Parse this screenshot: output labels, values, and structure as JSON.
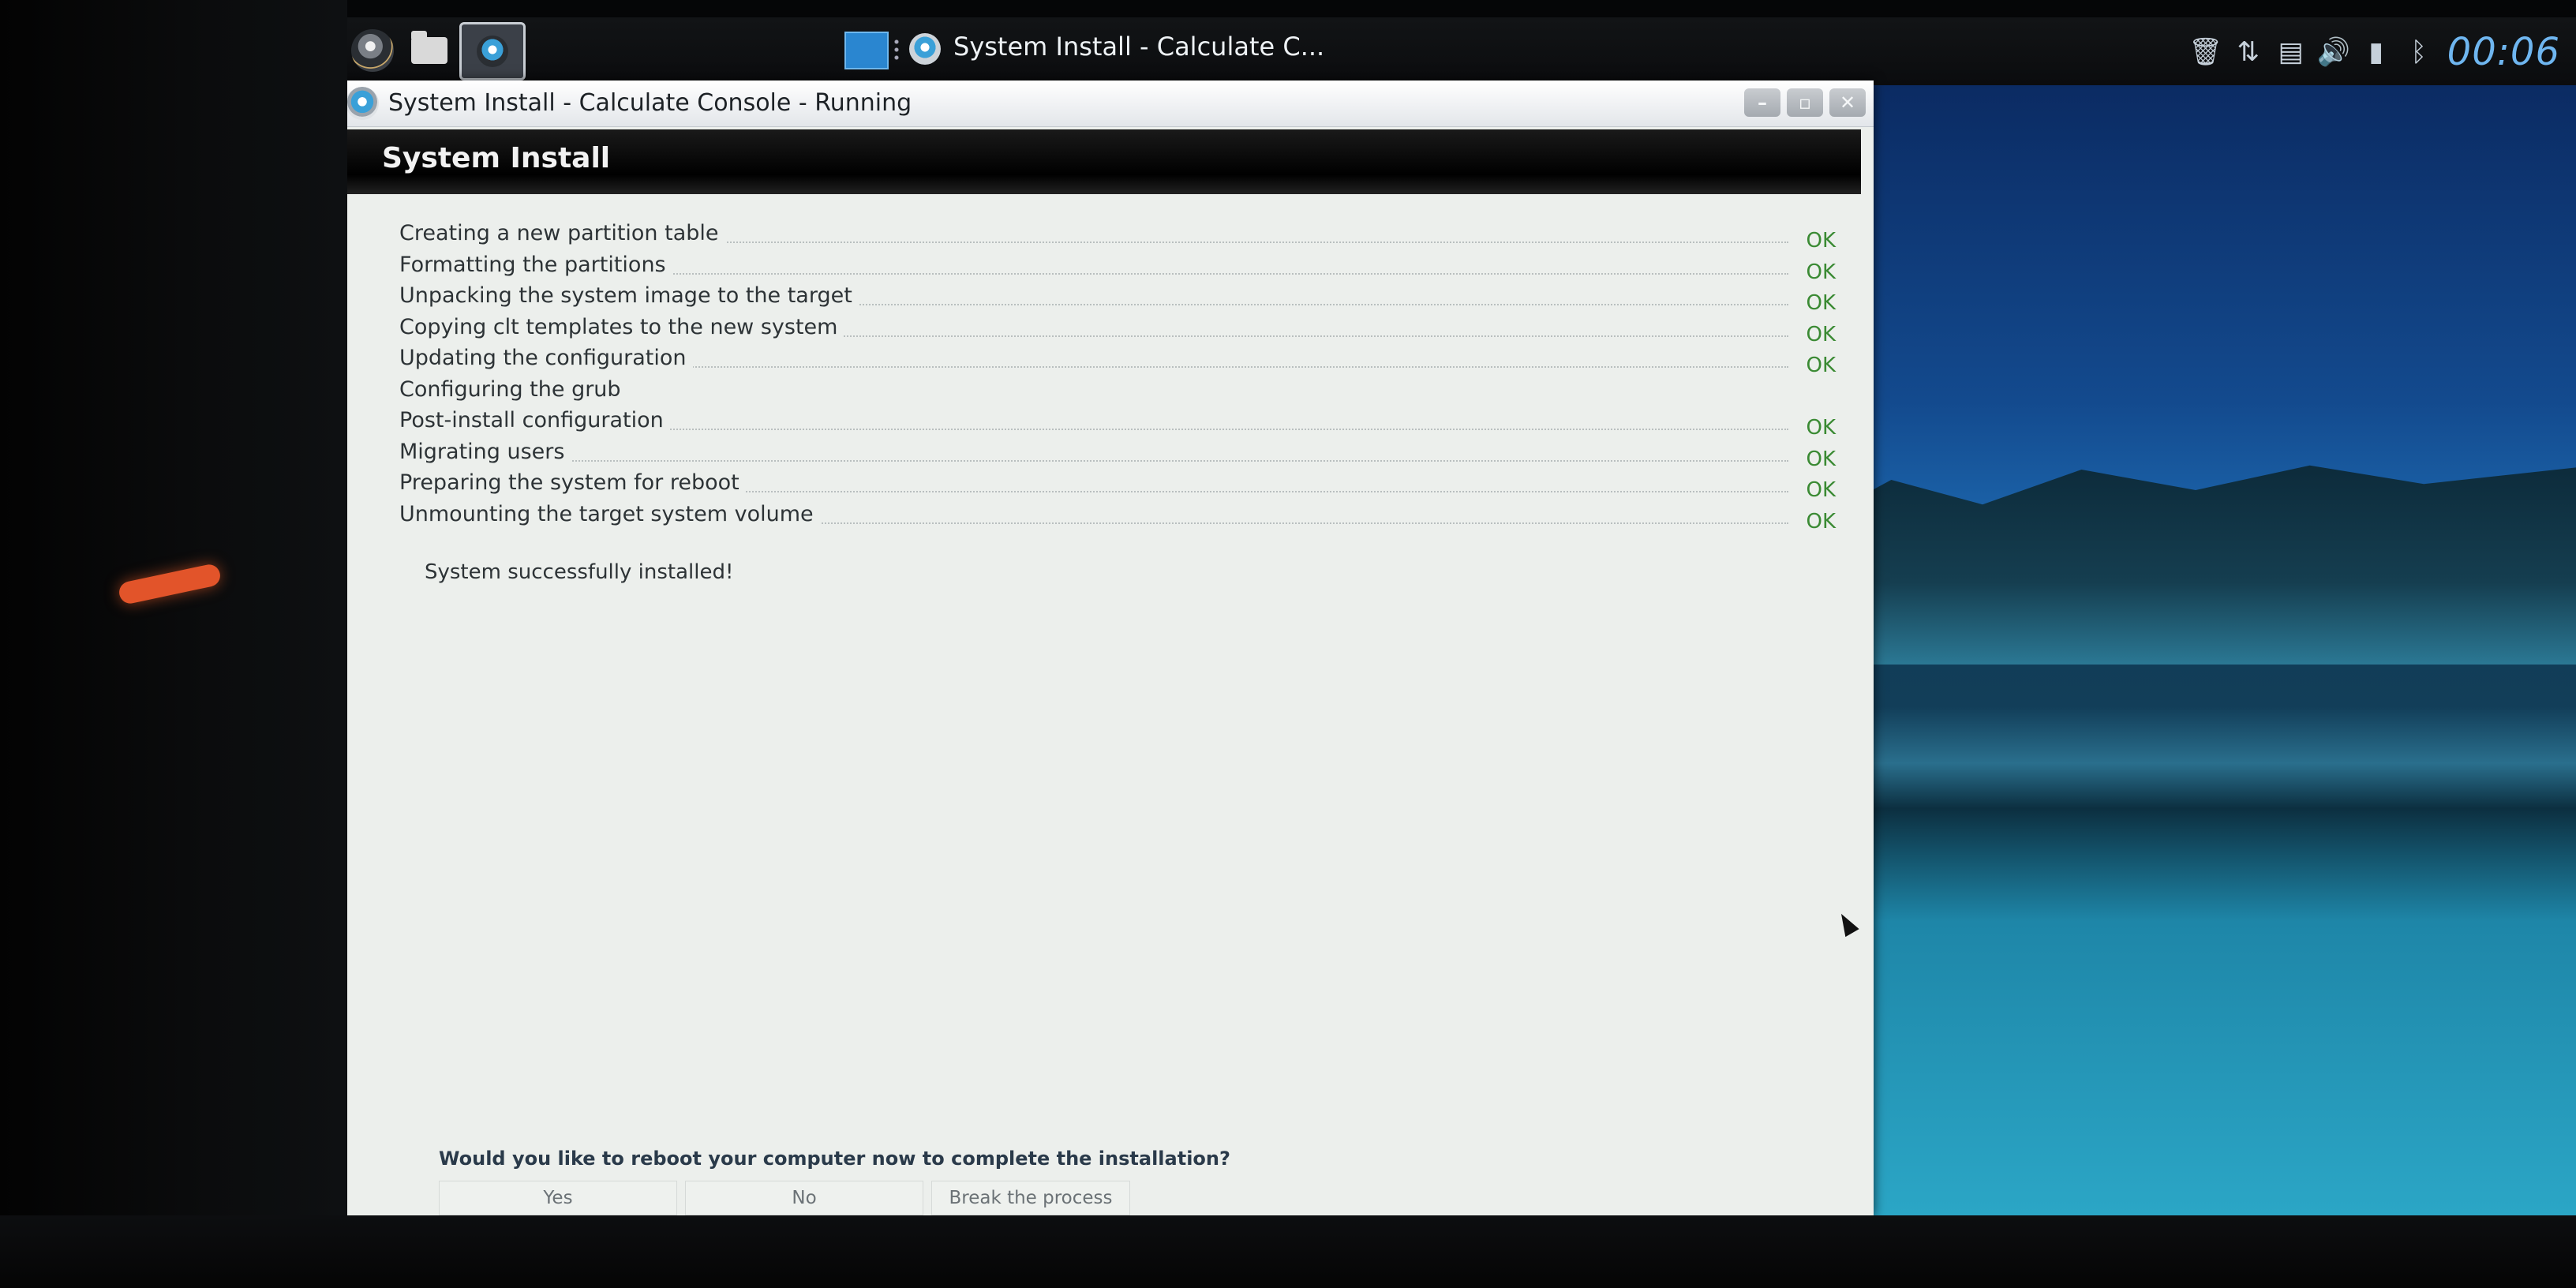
{
  "taskbar": {
    "task_title": "System Install - Calculate C...",
    "clock": "00:06",
    "tray_icons": [
      "trash-icon",
      "network-updown-icon",
      "clipboard-icon",
      "volume-icon",
      "battery-icon",
      "bluetooth-icon"
    ]
  },
  "window": {
    "title": "System Install - Calculate Console - Running",
    "controls": {
      "minimize": "–",
      "maximize": "▫",
      "close": "✕"
    }
  },
  "header": {
    "title": "System Install"
  },
  "log": {
    "rows": [
      {
        "label": "Creating a new partition table",
        "status": "OK"
      },
      {
        "label": "Formatting the partitions",
        "status": "OK"
      },
      {
        "label": "Unpacking the system image to the target",
        "status": "OK"
      },
      {
        "label": "Copying clt templates to the new system",
        "status": "OK"
      },
      {
        "label": "Updating the configuration",
        "status": "OK"
      },
      {
        "label": "Configuring the grub",
        "status": ""
      },
      {
        "label": "Post-install configuration",
        "status": "OK"
      },
      {
        "label": "Migrating users",
        "status": "OK"
      },
      {
        "label": "Preparing the system for reboot",
        "status": "OK"
      },
      {
        "label": "Unmounting the target system volume",
        "status": "OK"
      }
    ],
    "final_message": "System successfully installed!"
  },
  "prompt": {
    "question": "Would you like to reboot your computer now to complete the installation?",
    "yes_label": "Yes",
    "no_label": "No",
    "break_label": "Break the process"
  },
  "colors": {
    "ok_status": "#3a8a33",
    "clock": "#6fb6f0",
    "header_band": "#000000"
  }
}
